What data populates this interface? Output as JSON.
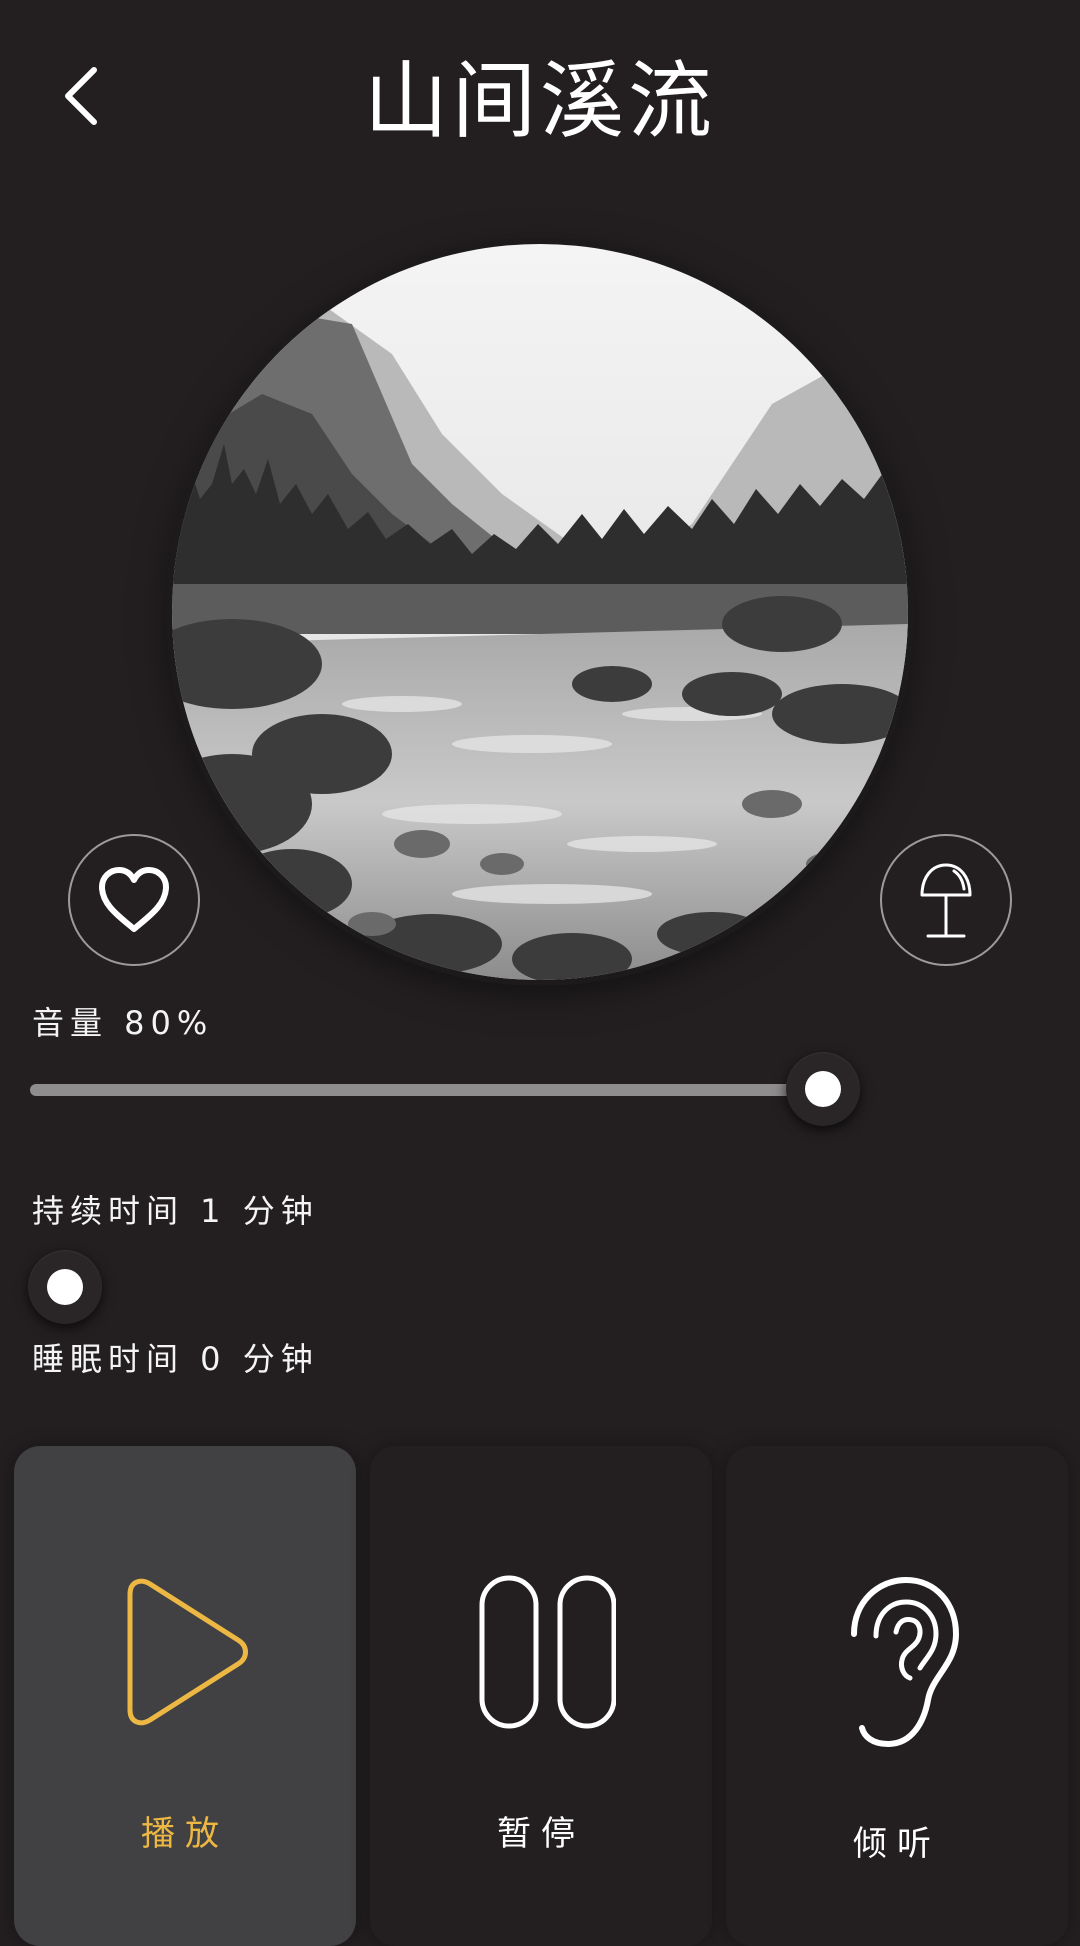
{
  "header": {
    "title": "山间溪流",
    "back_icon": "chevron-left-icon"
  },
  "artwork": {
    "subject": "mountain-stream-photo",
    "favorite_icon": "heart-icon",
    "lamp_icon": "lamp-icon"
  },
  "volume": {
    "label": "音量 80%",
    "value_percent": 80
  },
  "duration": {
    "label": "持续时间 1 分钟",
    "value_percent": 0
  },
  "sleep": {
    "label": "睡眠时间 0 分钟"
  },
  "controls": [
    {
      "label": "播放",
      "icon": "play-icon",
      "active": true
    },
    {
      "label": "暂停",
      "icon": "pause-icon",
      "active": false
    },
    {
      "label": "倾听",
      "icon": "ear-icon",
      "active": false
    }
  ],
  "colors": {
    "background": "#231f20",
    "active_card": "#414042",
    "accent": "#ecb843",
    "track": "#8f8d8e"
  }
}
